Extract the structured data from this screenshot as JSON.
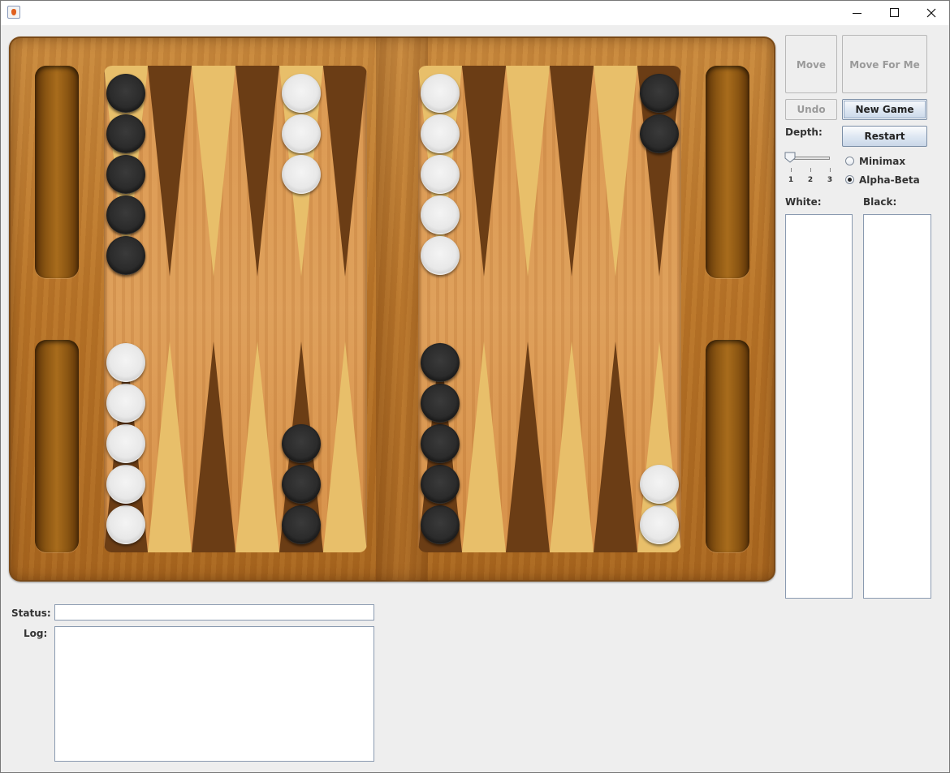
{
  "window": {
    "title": ""
  },
  "controls": {
    "move_label": "Move",
    "move_for_me_label": "Move For Me",
    "undo_label": "Undo",
    "new_game_label": "New Game",
    "restart_label": "Restart",
    "depth_label": "Depth:",
    "depth_ticks": [
      "1",
      "2",
      "3"
    ],
    "depth_value": 1,
    "algorithm_options": [
      "Minimax",
      "Alpha-Beta"
    ],
    "algorithm_selected": "Alpha-Beta",
    "white_label": "White:",
    "black_label": "Black:"
  },
  "status": {
    "label": "Status:",
    "value": ""
  },
  "log": {
    "label": "Log:",
    "value": ""
  },
  "board": {
    "colors": {
      "dark_point": "#6b3d15",
      "light_point": "#e8bf6a",
      "black_checker": "#2b2b2b",
      "white_checker": "#ececec"
    },
    "top_left": [
      {
        "color": "black",
        "count": 5
      },
      {
        "color": null,
        "count": 0
      },
      {
        "color": null,
        "count": 0
      },
      {
        "color": null,
        "count": 0
      },
      {
        "color": "white",
        "count": 3
      },
      {
        "color": null,
        "count": 0
      }
    ],
    "top_right": [
      {
        "color": "white",
        "count": 5
      },
      {
        "color": null,
        "count": 0
      },
      {
        "color": null,
        "count": 0
      },
      {
        "color": null,
        "count": 0
      },
      {
        "color": null,
        "count": 0
      },
      {
        "color": "black",
        "count": 2
      }
    ],
    "bottom_left": [
      {
        "color": "white",
        "count": 5
      },
      {
        "color": null,
        "count": 0
      },
      {
        "color": null,
        "count": 0
      },
      {
        "color": null,
        "count": 0
      },
      {
        "color": "black",
        "count": 3
      },
      {
        "color": null,
        "count": 0
      }
    ],
    "bottom_right": [
      {
        "color": "black",
        "count": 5
      },
      {
        "color": null,
        "count": 0
      },
      {
        "color": null,
        "count": 0
      },
      {
        "color": null,
        "count": 0
      },
      {
        "color": null,
        "count": 0
      },
      {
        "color": "white",
        "count": 2
      }
    ]
  }
}
